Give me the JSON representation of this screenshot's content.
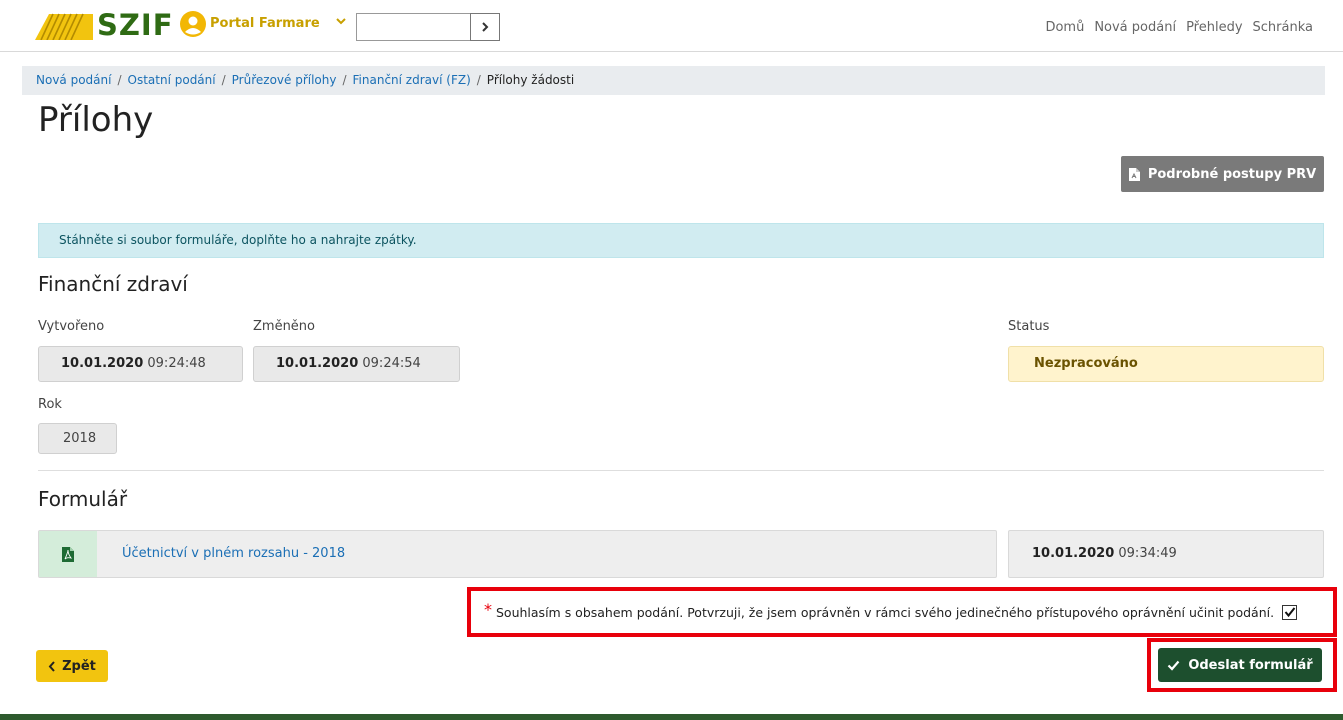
{
  "header": {
    "brand": "SZIF",
    "portal_label": "Portal Farmare",
    "search_value": "",
    "nav": [
      "Domů",
      "Nová podání",
      "Přehledy",
      "Schránka"
    ]
  },
  "breadcrumb": {
    "items": [
      "Nová podání",
      "Ostatní podání",
      "Průřezové přílohy",
      "Finanční zdraví (FZ)"
    ],
    "current": "Přílohy žádosti"
  },
  "page": {
    "title": "Přílohy",
    "guide_button": "Podrobné postupy PRV",
    "info": "Stáhněte si soubor formuláře, doplňte ho a nahrajte zpátky."
  },
  "details": {
    "section_title": "Finanční zdraví",
    "created_label": "Vytvořeno",
    "created_date": "10.01.2020",
    "created_time": "09:24:48",
    "changed_label": "Změněno",
    "changed_date": "10.01.2020",
    "changed_time": "09:24:54",
    "status_label": "Status",
    "status_value": "Nezpracováno",
    "year_label": "Rok",
    "year_value": "2018"
  },
  "form": {
    "section_title": "Formulář",
    "file_name": "Účetnictví v plném rozsahu - 2018",
    "file_date": "10.01.2020",
    "file_time": "09:34:49"
  },
  "consent": {
    "required_mark": "*",
    "text": "Souhlasím s obsahem podání. Potvrzuji, že jsem oprávněn v rámci svého jedinečného přístupového oprávnění učinit podání.",
    "checked": true
  },
  "actions": {
    "back_label": "Zpět",
    "submit_label": "Odeslat formulář"
  },
  "colors": {
    "brand_green": "#2f6b14",
    "accent_yellow": "#f2c40f",
    "submit_green": "#1d4f2e",
    "highlight_red": "#e8000b"
  },
  "icons": [
    "user-icon",
    "chevron-down-icon",
    "chevron-right-icon",
    "pdf-icon",
    "chevron-left-icon",
    "check-icon"
  ]
}
